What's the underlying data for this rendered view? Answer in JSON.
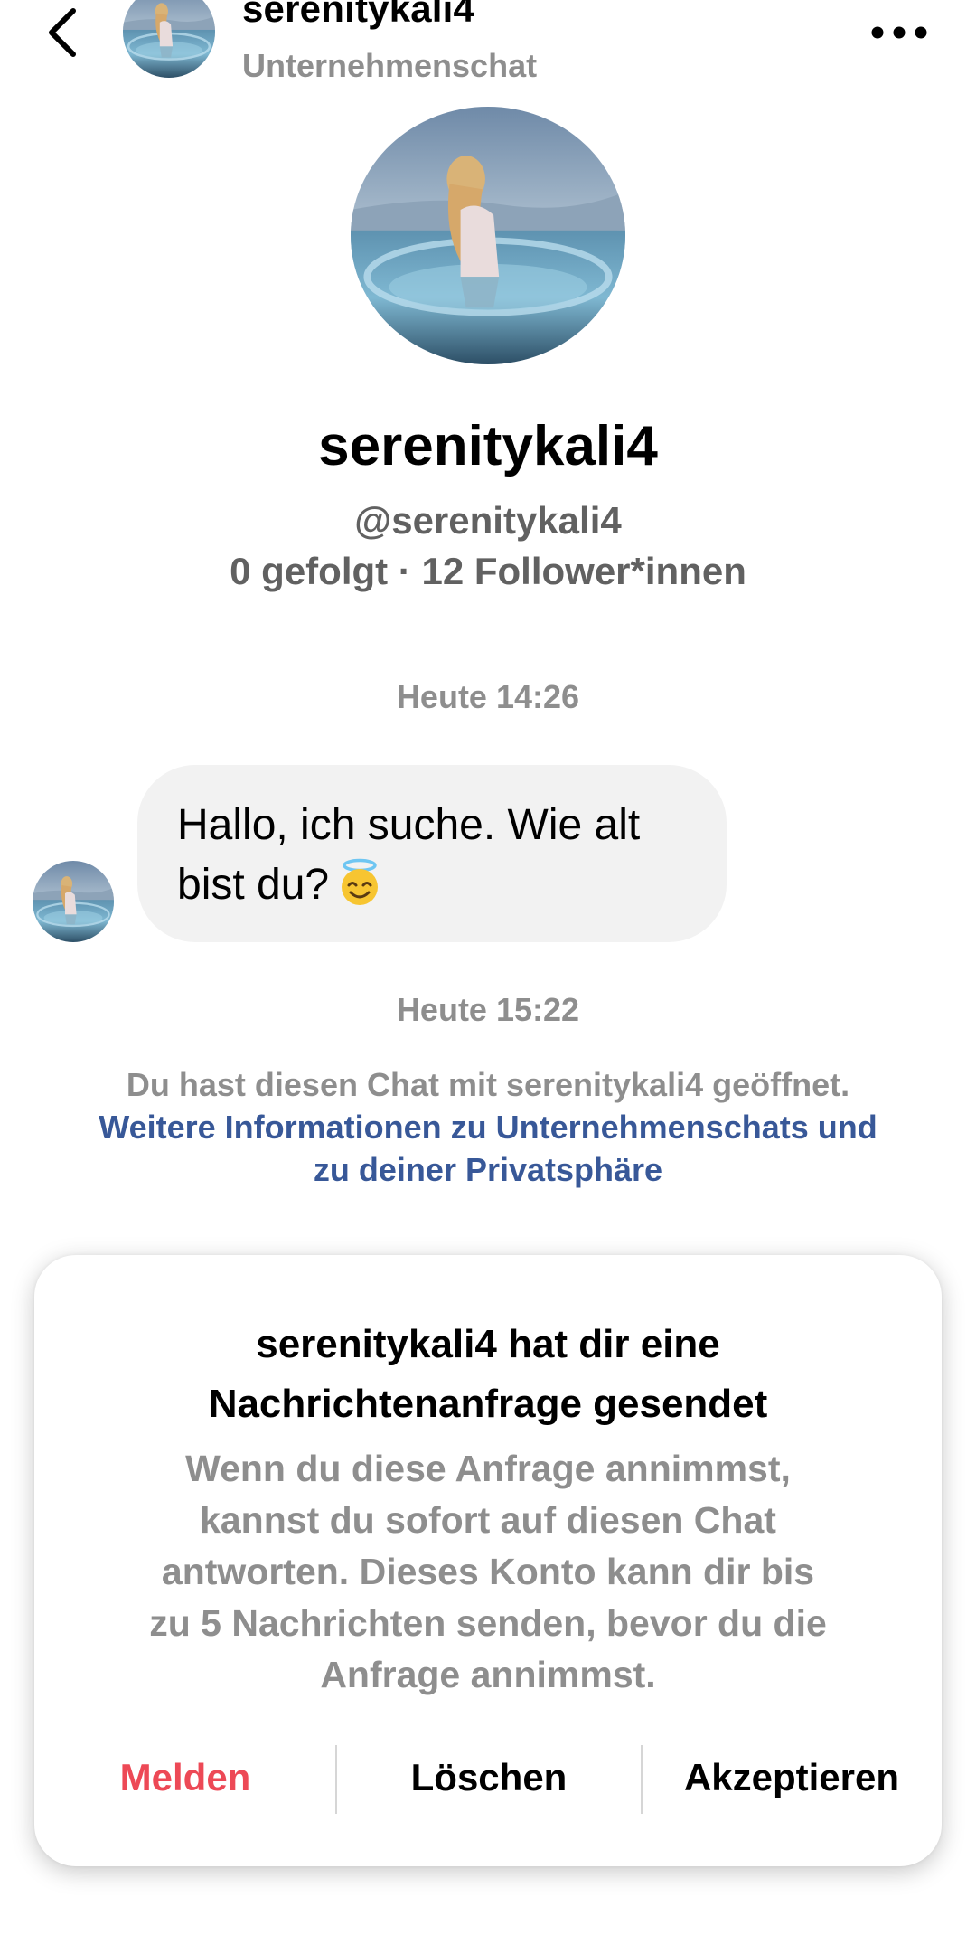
{
  "header": {
    "back_icon": "chevron-left-icon",
    "name": "serenitykali4",
    "subtitle": "Unternehmenschat",
    "more_icon": "more-horizontal-icon"
  },
  "profile": {
    "name": "serenitykali4",
    "handle": "@serenitykali4",
    "stats": "0 gefolgt · 12 Follower*innen"
  },
  "timestamps": {
    "first": "Heute 14:26",
    "second": "Heute 15:22"
  },
  "message": {
    "line1": "Hallo, ich suche. Wie alt",
    "line2": "bist du?",
    "emoji_icon": "smiling-face-with-halo-icon"
  },
  "notice": {
    "text": "Du hast diesen Chat mit serenitykali4 geöffnet.",
    "link_line1": "Weitere Informationen zu Unternehmenschats und",
    "link_line2": "zu deiner Privatsphäre"
  },
  "request_card": {
    "title_line1": "serenitykali4 hat dir eine",
    "title_line2": "Nachrichtenanfrage gesendet",
    "body_lines": [
      "Wenn du diese Anfrage annimmst,",
      "kannst du sofort auf diesen Chat",
      "antworten. Dieses Konto kann dir bis",
      "zu 5 Nachrichten senden, bevor du die",
      "Anfrage annimmst."
    ],
    "report_label": "Melden",
    "delete_label": "Löschen",
    "accept_label": "Akzeptieren"
  },
  "colors": {
    "secondary_text": "#8e8e8e",
    "link": "#385898",
    "destructive": "#ed4956",
    "bubble": "#f2f2f2"
  }
}
